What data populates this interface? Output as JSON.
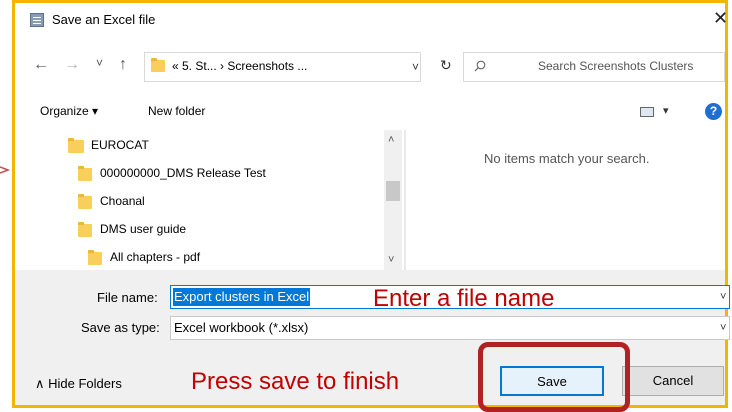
{
  "dialog": {
    "title": "Save an Excel file",
    "close_glyph": "✕"
  },
  "nav": {
    "back_glyph": "←",
    "forward_glyph": "→",
    "recent_glyph": "˅",
    "up_glyph": "↑",
    "path": "«  5. St...  ›  Screenshots ...",
    "path_dropdown_glyph": "˅",
    "refresh_glyph": "↻",
    "search_placeholder": "Search Screenshots Clusters"
  },
  "toolbar": {
    "organize_label": "Organize ▾",
    "new_folder_label": "New folder",
    "view_dropdown_glyph": "▾",
    "help_glyph": "?"
  },
  "tree": {
    "items": [
      {
        "label": "EUROCAT"
      },
      {
        "label": "000000000_DMS Release Test"
      },
      {
        "label": "Choanal"
      },
      {
        "label": "DMS user guide"
      },
      {
        "label": "All chapters - pdf"
      }
    ],
    "scroll_up_glyph": "˄",
    "scroll_down_glyph": "˅"
  },
  "results": {
    "empty_message": "No items match your search."
  },
  "form": {
    "file_name_label": "File name:",
    "file_name_value": "Export clusters in Excel",
    "save_type_label": "Save as type:",
    "save_type_value": "Excel workbook (*.xlsx)",
    "dropdown_glyph": "˅"
  },
  "footer": {
    "hide_folders_label": "∧  Hide Folders",
    "save_label": "Save",
    "cancel_label": "Cancel"
  },
  "annotations": {
    "enter_name": "Enter a file name",
    "press_save": "Press save to finish"
  },
  "colors": {
    "frame": "#f4b400",
    "annotation": "#c00000",
    "selection": "#0078d7",
    "folder": "#f7cf5a"
  }
}
